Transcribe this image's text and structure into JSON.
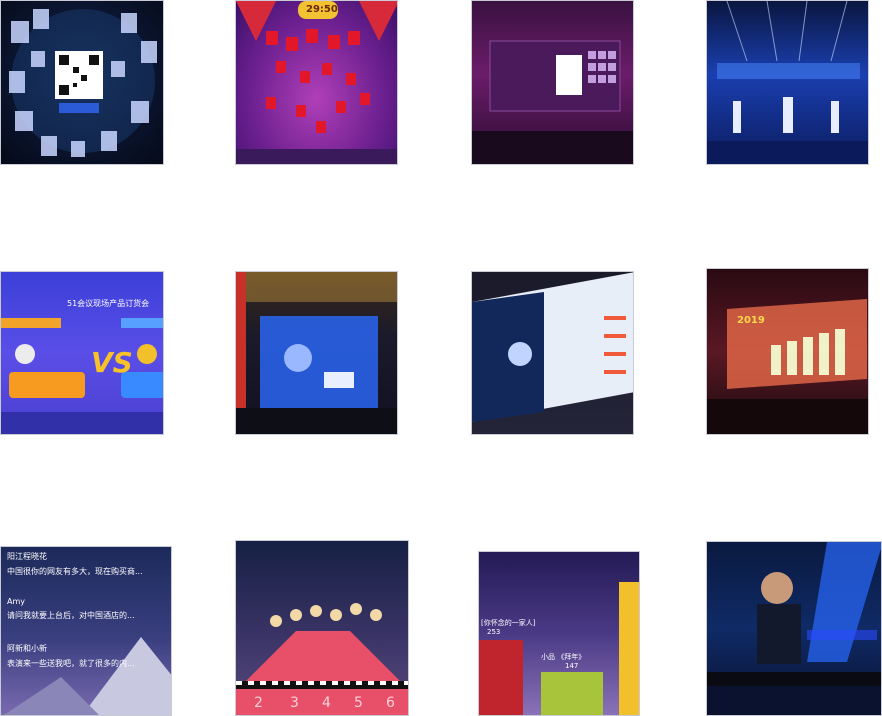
{
  "tiles": [
    {
      "id": 1,
      "caption": ""
    },
    {
      "id": 2,
      "timer": "29:50"
    },
    {
      "id": 3,
      "caption": ""
    },
    {
      "id": 4,
      "caption": ""
    },
    {
      "id": 5,
      "title": "51会议现场产品订货会",
      "vs": "VS"
    },
    {
      "id": 6,
      "caption": ""
    },
    {
      "id": 7,
      "caption": ""
    },
    {
      "id": 8,
      "caption": "2019"
    },
    {
      "id": 9,
      "users": [
        {
          "name": "阳江程晓花",
          "text": "中国很你的网友有多大，现在购买商..."
        },
        {
          "name": "Amy",
          "text": "请问我就要上台后，对中国酒店的..."
        },
        {
          "name": "阿新和小新",
          "text": "表演来一些送我吧，就了很多的内..."
        }
      ]
    },
    {
      "id": 10,
      "lanes": [
        "2",
        "3",
        "4",
        "5",
        "6"
      ]
    },
    {
      "id": 11,
      "bars": [
        {
          "label": "[你怀念的一家人]",
          "value": "253"
        },
        {
          "label": "小品 《拜年》",
          "value": "147"
        },
        {
          "label": "",
          "value": ""
        }
      ]
    },
    {
      "id": 12,
      "caption": ""
    }
  ]
}
